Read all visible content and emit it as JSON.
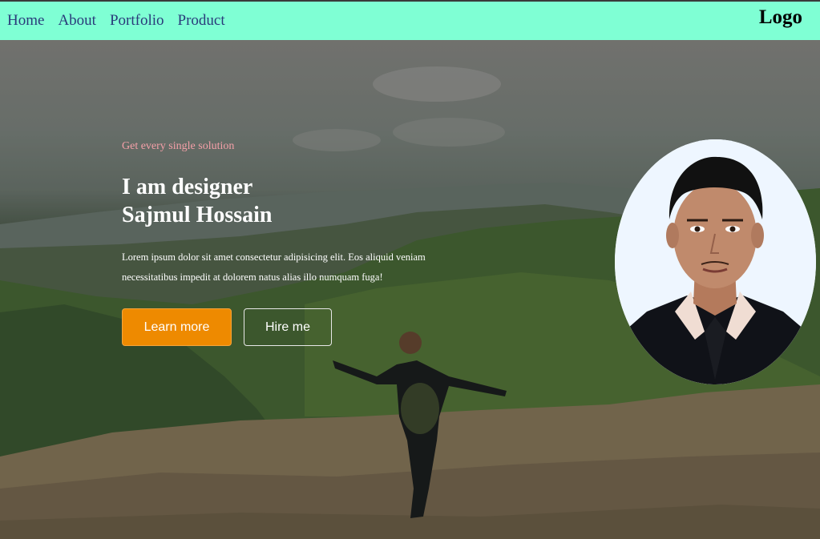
{
  "nav": {
    "items": [
      "Home",
      "About",
      "Portfolio",
      "Product"
    ],
    "logo": "Logo"
  },
  "hero": {
    "eyebrow": "Get every single solution",
    "heading_line1": "I am designer",
    "heading_line2": "Sajmul Hossain",
    "paragraph_line1": "Lorem ipsum dolor sit amet consectetur adipisicing elit. Eos aliquid veniam",
    "paragraph_line2": "necessitatibus impedit at dolorem natus alias illo numquam fuga!",
    "learn_more": "Learn more",
    "hire_me": "Hire me"
  },
  "colors": {
    "nav_bg": "#7fffd4",
    "nav_link": "#2a3a7a",
    "eyebrow": "#f4a0a8",
    "accent_button": "#ee8a00"
  }
}
